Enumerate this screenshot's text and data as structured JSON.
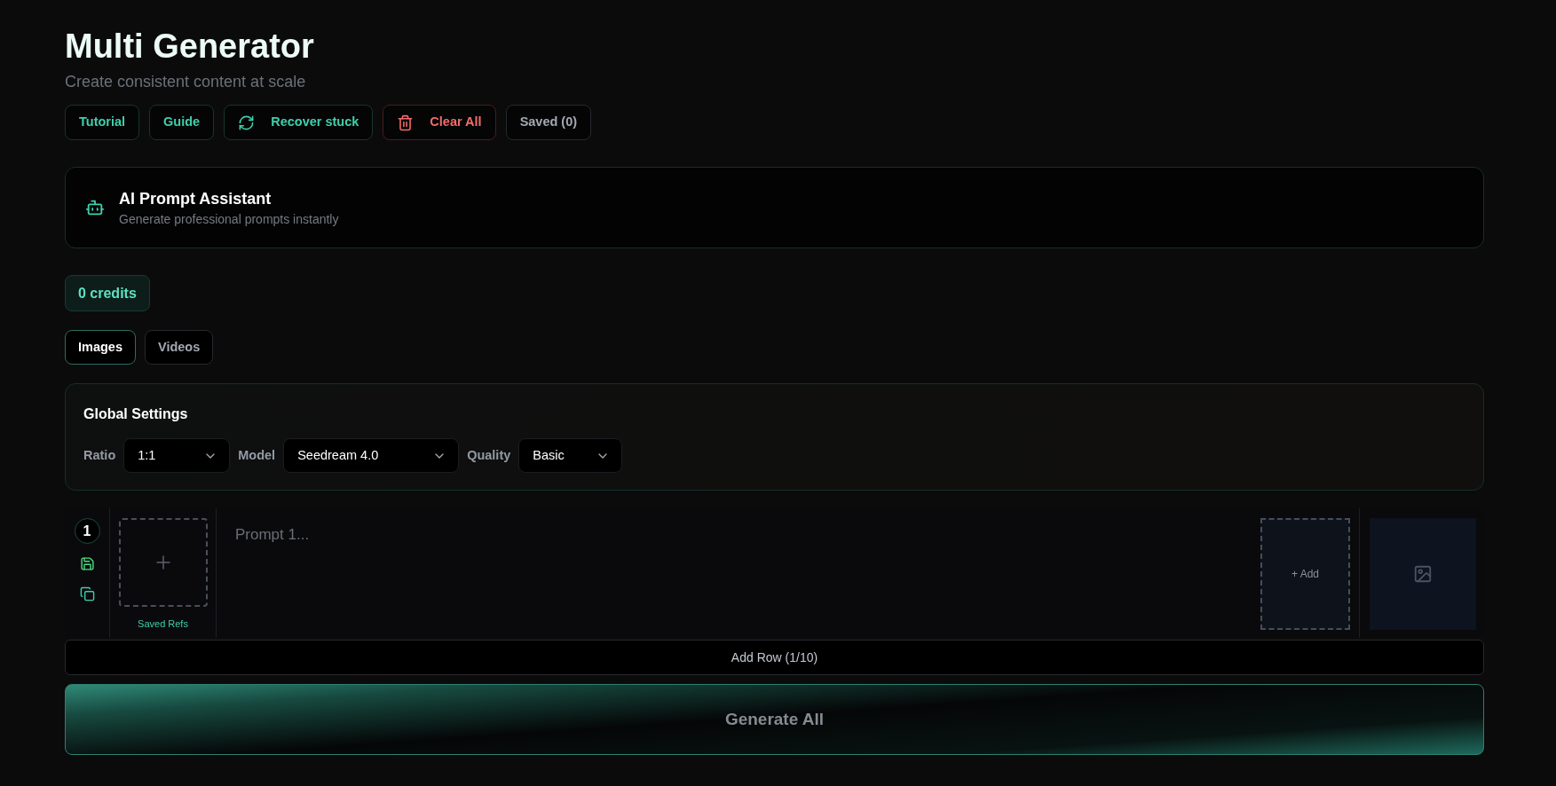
{
  "header": {
    "title": "Multi Generator",
    "subtitle": "Create consistent content at scale"
  },
  "toolbar": [
    {
      "label": "Tutorial",
      "kind": "accent"
    },
    {
      "label": "Guide",
      "kind": "accent"
    },
    {
      "label": "Recover stuck",
      "kind": "refresh"
    },
    {
      "label": "Clear All",
      "kind": "delete"
    },
    {
      "label": "Saved (0)",
      "kind": "muted"
    }
  ],
  "assistant": {
    "title": "AI Prompt Assistant",
    "subtitle": "Generate professional prompts instantly"
  },
  "credits": "0 credits",
  "tabs": [
    {
      "label": "Images",
      "selected": true
    },
    {
      "label": "Videos",
      "selected": false
    }
  ],
  "global_settings": {
    "title": "Global Settings",
    "fields": [
      {
        "label": "Ratio",
        "value": "1:1"
      },
      {
        "label": "Model",
        "value": "Seedream 4.0"
      },
      {
        "label": "Quality",
        "value": "Basic"
      }
    ]
  },
  "rows": [
    {
      "number": "1",
      "refs_label": "Saved Refs",
      "placeholder": "Prompt 1...",
      "add_label": "+ Add"
    }
  ],
  "add_row": "Add Row (1/10)",
  "generate_button": {
    "label": "Generate All",
    "disabled": true
  }
}
